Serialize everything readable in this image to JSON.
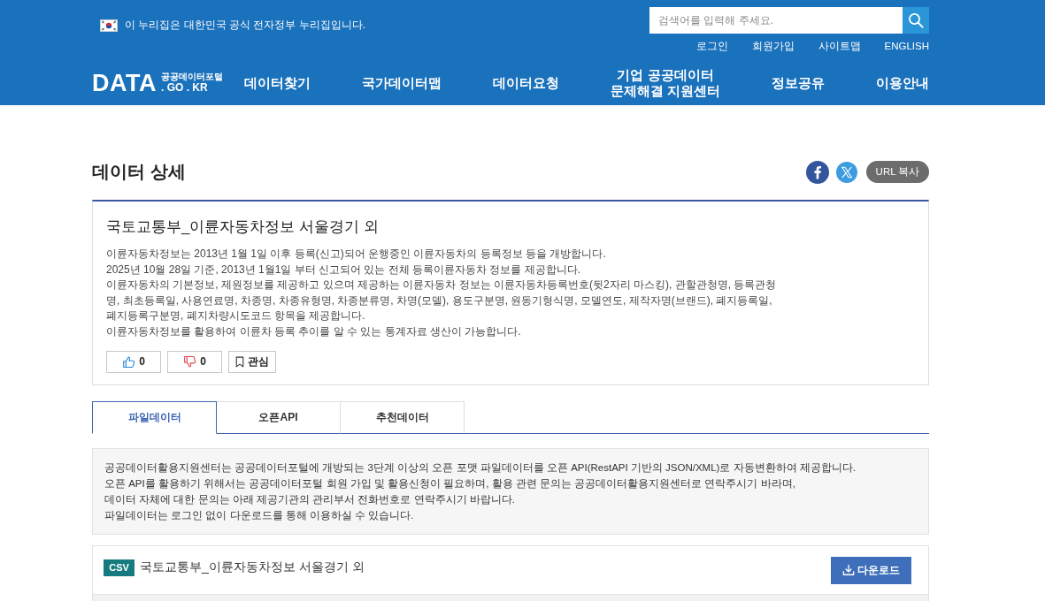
{
  "header": {
    "gov_notice": "이 누리집은 대한민국 공식 전자정부 누리집입니다.",
    "search": {
      "placeholder": "검색어를 입력해 주세요."
    },
    "utility_links": [
      "로그인",
      "회원가입",
      "사이트맵",
      "ENGLISH"
    ],
    "logo": {
      "wordmark": "DATA",
      "subtitle": "공공데이터포털",
      "domain": ". GO . KR"
    },
    "nav": [
      {
        "label": "데이터찾기"
      },
      {
        "label": "국가데이터맵"
      },
      {
        "label": "데이터요청"
      },
      {
        "label": "기업 공공데이터\n문제해결 지원센터"
      },
      {
        "label": "정보공유"
      },
      {
        "label": "이용안내"
      }
    ]
  },
  "page_title": "데이터 상세",
  "share": {
    "copy_url_label": "URL 복사"
  },
  "dataset": {
    "title": "국토교통부_이륜자동차정보 서울경기 외",
    "description": [
      "이륜자동차정보는 2013년 1월 1일 이후 등록(신고)되어 운행중인 이륜자동차의 등록정보 등을 개방합니다.",
      "2025년 10월 28일 기준, 2013년 1월1일 부터 신고되어 있는 전체 등록이륜자동차 정보를 제공합니다.",
      "이륜자동차의 기본정보, 제원정보를 제공하고 있으며 제공하는 이륜자동차 정보는 이륜자동차등록번호(뒷2자리 마스킹), 관할관청명, 등록관청명, 최초등록일, 사용연료명, 차종명, 차종유형명, 차종분류명, 차명(모델), 용도구분명, 원동기형식명, 모델연도, 제작자명(브랜드), 폐지등록일, 폐지등록구분명, 폐지차량시도코드 항목을 제공합니다.",
      "이륜자동차정보를 활용하여 이륜차 등록 추이를 알 수 있는 통계자료 생산이 가능합니다."
    ],
    "reactions": [
      {
        "kind": "like",
        "count": "0"
      },
      {
        "kind": "dislike",
        "count": "0"
      },
      {
        "kind": "bookmark",
        "label": "관심"
      }
    ]
  },
  "tabs": [
    {
      "label": "파일데이터",
      "selected": true
    },
    {
      "label": "오픈API",
      "selected": false
    },
    {
      "label": "추천데이터",
      "selected": false
    }
  ],
  "notice": {
    "lines": [
      "공공데이터활용지원센터는 공공데이터포털에 개방되는 3단계 이상의 오픈 포맷 파일데이터를 오픈 API(RestAPI 기반의 JSON/XML)로 자동변환하여 제공합니다.",
      "오픈 API를 활용하기 위해서는 공공데이터포털 회원 가입 및 활용신청이 필요하며, 활용 관련 문의는 공공데이터활용지원센터로 연락주시기 바라며,",
      "데이터 자체에 대한 문의는 아래 제공기관의 관리부서 전화번호로 연락주시기 바랍니다.",
      "파일데이터는 로그인 없이 다운로드를 통해 이용하실 수 있습니다."
    ]
  },
  "files": [
    {
      "format": "CSV",
      "title": "국토교통부_이륜자동차정보 서울경기 외",
      "action_label": "다운로드"
    }
  ]
}
